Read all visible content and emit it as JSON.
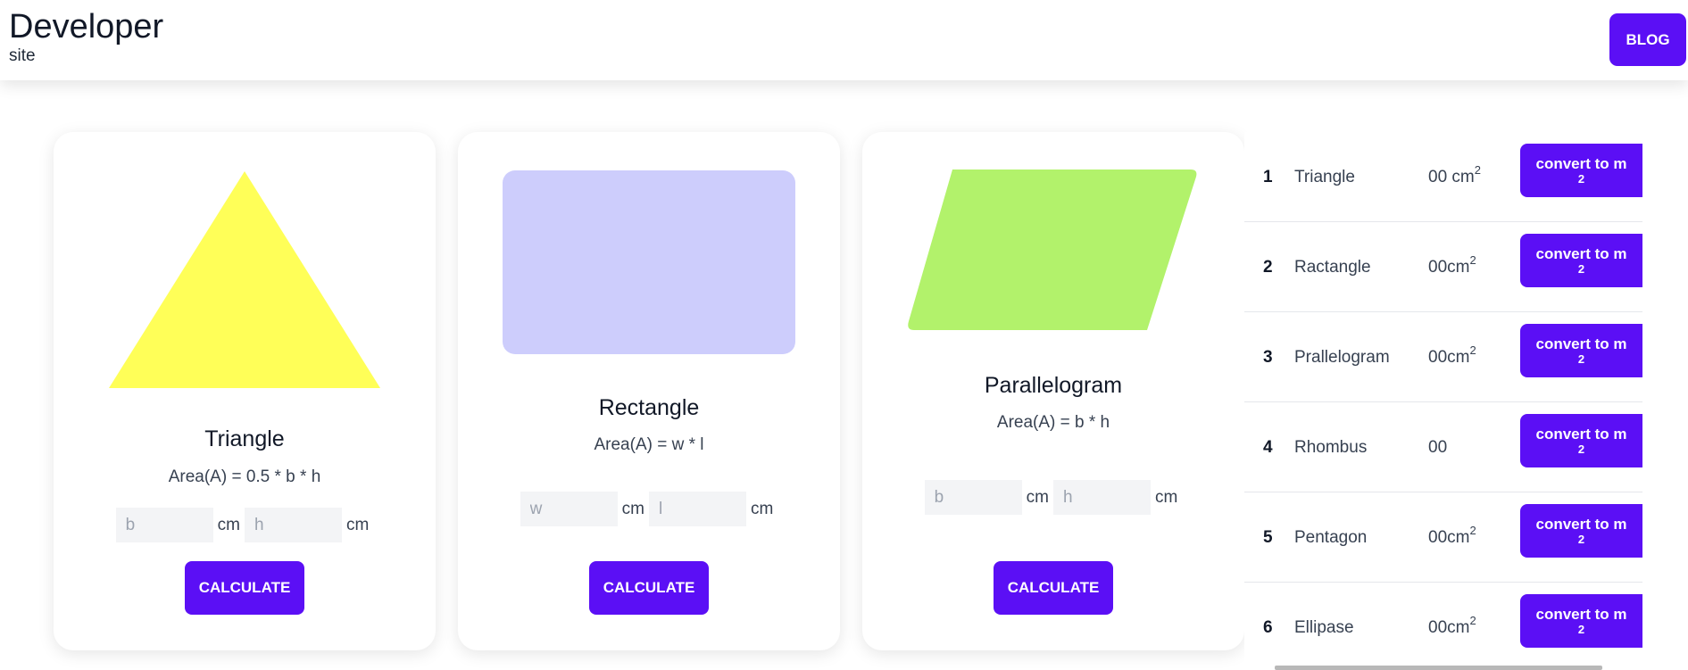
{
  "header": {
    "title": "Developer",
    "subtitle": "site",
    "blog_label": "BLOG"
  },
  "cards": [
    {
      "title": "Triangle",
      "formula": "Area(A) = 0.5 * b * h",
      "inputs": [
        {
          "placeholder": "b"
        },
        {
          "placeholder": "h"
        }
      ],
      "unit": "cm",
      "button": "CALCULATE",
      "color": "#ffff58"
    },
    {
      "title": "Rectangle",
      "formula": "Area(A) = w * l",
      "inputs": [
        {
          "placeholder": "w"
        },
        {
          "placeholder": "l"
        }
      ],
      "unit": "cm",
      "button": "CALCULATE",
      "color": "#cdcdfc"
    },
    {
      "title": "Parallelogram",
      "formula": "Area(A) = b * h",
      "inputs": [
        {
          "placeholder": "b"
        },
        {
          "placeholder": "h"
        }
      ],
      "unit": "cm",
      "button": "CALCULATE",
      "color": "#b2f26b"
    }
  ],
  "table": {
    "button_label": "convert to m",
    "button_sup": "2",
    "rows": [
      {
        "num": "1",
        "name": "Triangle",
        "value": "00 cm",
        "sup": "2"
      },
      {
        "num": "2",
        "name": "Ractangle",
        "value": "00cm",
        "sup": "2"
      },
      {
        "num": "3",
        "name": "Prallelogram",
        "value": "00cm",
        "sup": "2"
      },
      {
        "num": "4",
        "name": "Rhombus",
        "value": "00",
        "sup": ""
      },
      {
        "num": "5",
        "name": "Pentagon",
        "value": "00cm",
        "sup": "2"
      },
      {
        "num": "6",
        "name": "Ellipase",
        "value": "00cm",
        "sup": "2"
      }
    ]
  },
  "colors": {
    "accent": "#5b0ff5"
  }
}
